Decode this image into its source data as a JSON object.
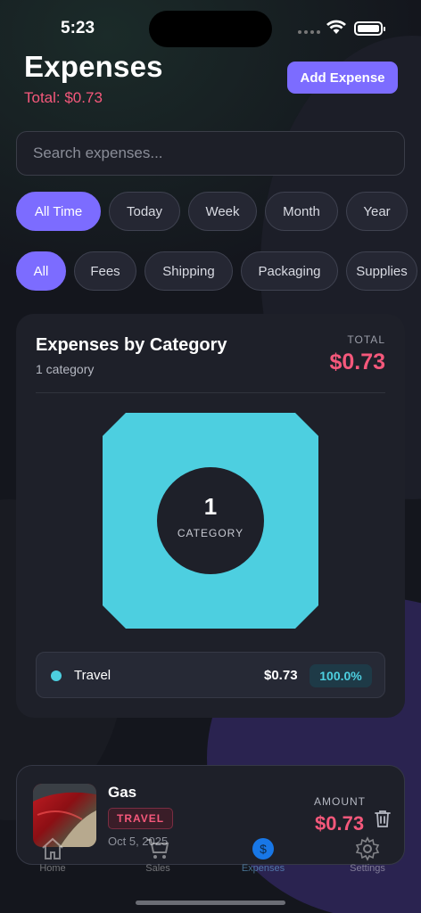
{
  "status": {
    "time": "5:23"
  },
  "header": {
    "title": "Expenses",
    "total": "Total: $0.73",
    "add_label": "Add Expense"
  },
  "search": {
    "placeholder": "Search expenses..."
  },
  "time_filters": [
    "All Time",
    "Today",
    "Week",
    "Month",
    "Year"
  ],
  "time_filter_selected": "All Time",
  "category_filters": [
    "All",
    "Fees",
    "Shipping",
    "Packaging",
    "Supplies"
  ],
  "category_filter_selected": "All",
  "summary": {
    "title": "Expenses by Category",
    "subtitle": "1 category",
    "total_label": "TOTAL",
    "total_value": "$0.73",
    "center_number": "1",
    "center_label": "CATEGORY",
    "legend": [
      {
        "name": "Travel",
        "amount": "$0.73",
        "percent": "100.0%",
        "color": "#4dcfe0"
      }
    ]
  },
  "expenses": [
    {
      "name": "Gas",
      "category": "TRAVEL",
      "date": "Oct 5, 2025",
      "amount_label": "AMOUNT",
      "amount": "$0.73"
    }
  ],
  "tabs": [
    {
      "label": "Home",
      "icon": "home-icon"
    },
    {
      "label": "Sales",
      "icon": "cart-icon"
    },
    {
      "label": "Expenses",
      "icon": "dollar-icon"
    },
    {
      "label": "Settings",
      "icon": "gear-icon"
    }
  ],
  "active_tab": "Expenses",
  "colors": {
    "accent": "#7c6cff",
    "negative": "#f5587b",
    "travel": "#4dcfe0"
  }
}
